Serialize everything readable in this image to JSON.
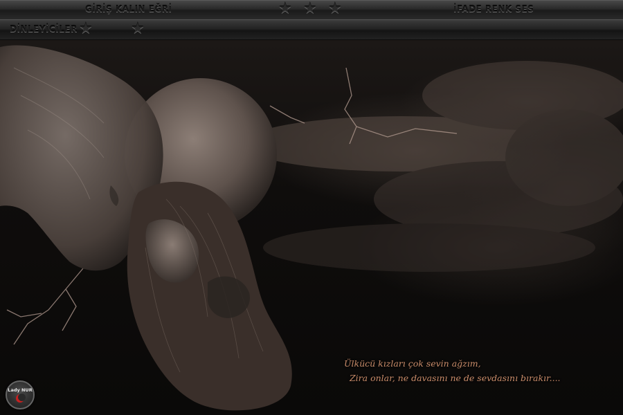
{
  "toolbar": {
    "format_label": "GİRİŞ KALIN EĞRİ",
    "media_label": "İFADE RENK SES"
  },
  "listeners": {
    "label": "DİNLEYİCİLER"
  },
  "icons": {
    "star": "★"
  },
  "quote": {
    "line1": "Ülkücü kızları çok sevin ağzım,",
    "line2": "Zira onlar, ne davasını ne de sevdasını bırakır...."
  },
  "logo": {
    "text": "Lady NUR"
  },
  "colors": {
    "quote": "#c98c6a",
    "bar_dark": "#1a1a1a",
    "crescent": "#c62020"
  }
}
